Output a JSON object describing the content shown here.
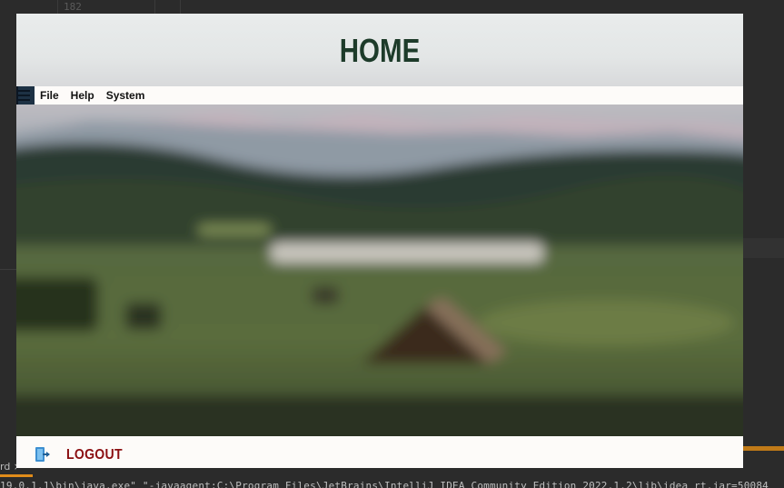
{
  "ide": {
    "line_number": "182",
    "tab_label": "rd ×",
    "console_line": "19.0.1.1\\bin\\java.exe\" \"-javaagent:C:\\Program Files\\JetBrains\\IntelliJ IDEA Community Edition 2022.1.2\\lib\\idea_rt.jar=50084"
  },
  "app": {
    "title": "HOME",
    "menu": [
      "File",
      "Help",
      "System"
    ],
    "logout_label": "LOGOUT"
  },
  "colors": {
    "title": "#1d3b2a",
    "logout": "#8b0f12",
    "menu_bg": "#fdfbf9",
    "ide_bg": "#2b2b2b",
    "ide_accent": "#e08c1a"
  },
  "icons": {
    "menu": "hamburger-icon",
    "logout": "logout-door-icon"
  }
}
